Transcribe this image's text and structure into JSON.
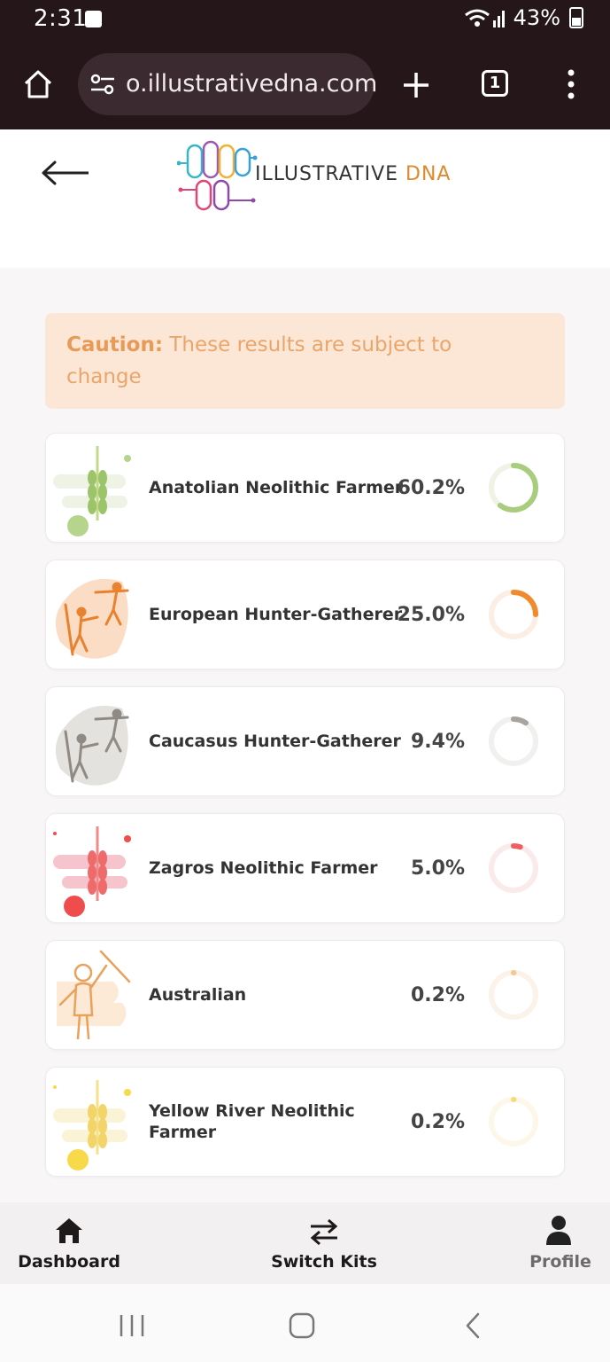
{
  "status_bar": {
    "time": "2:31",
    "signal_text": "43%"
  },
  "browser": {
    "url": "o.illustrativedna.com",
    "tab_count": "1"
  },
  "header": {
    "logo_main": "ILLUSTRATIVE",
    "logo_accent": "DNA"
  },
  "caution": {
    "label": "Caution:",
    "message": "These results are subject to change"
  },
  "results": [
    {
      "name": "Anatolian Neolithic Farmer",
      "percent": "60.2%",
      "value": 60.2,
      "color": "#a9cc7e",
      "track": "#eef3e6"
    },
    {
      "name": "European Hunter-Gatherer",
      "percent": "25.0%",
      "value": 25.0,
      "color": "#f08a2c",
      "track": "#fbeee4"
    },
    {
      "name": "Caucasus Hunter-Gatherer",
      "percent": "9.4%",
      "value": 9.4,
      "color": "#a7a39d",
      "track": "#f1f0ef"
    },
    {
      "name": "Zagros Neolithic Farmer",
      "percent": "5.0%",
      "value": 5.0,
      "color": "#ef5f5f",
      "track": "#fbeaea"
    },
    {
      "name": "Australian",
      "percent": "0.2%",
      "value": 0.2,
      "color": "#f3c98f",
      "track": "#fbf3ea"
    },
    {
      "name": "Yellow River Neolithic Farmer",
      "percent": "0.2%",
      "value": 0.2,
      "color": "#f5dc7a",
      "track": "#fcf7e9"
    }
  ],
  "bottom_nav": [
    {
      "label": "Dashboard",
      "icon": "home-icon",
      "color": "#1f1a1a"
    },
    {
      "label": "Switch Kits",
      "icon": "swap-icon",
      "color": "#1f1a1a"
    },
    {
      "label": "Profile",
      "icon": "person-icon",
      "color": "#6f6b6b"
    }
  ]
}
